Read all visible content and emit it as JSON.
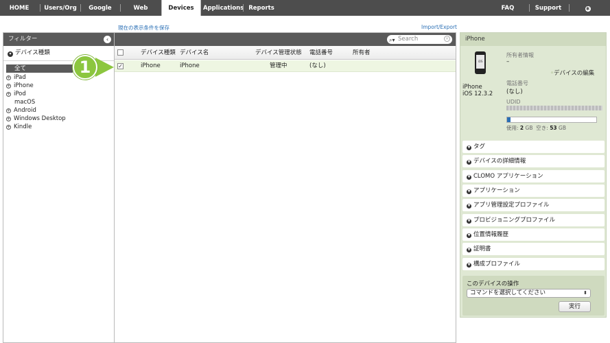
{
  "nav": {
    "home": "HOME",
    "users": "Users/Org",
    "google": "Google Apps",
    "web": "Web Access",
    "devices": "Devices",
    "applications": "Applications",
    "reports": "Reports",
    "faq": "FAQ",
    "support": "Support",
    "settings": "Settings"
  },
  "links": {
    "save_view": "現在の表示条件を保存",
    "import_export": "Import/Export"
  },
  "filter": {
    "title": "フィルター",
    "group": "デバイス種類",
    "items": [
      "全て",
      "iPad",
      "iPhone",
      "iPod",
      "macOS",
      "Android",
      "Windows Desktop",
      "Kindle"
    ]
  },
  "callout": {
    "number": "1"
  },
  "search": {
    "placeholder": "Search"
  },
  "table": {
    "headers": {
      "type": "デバイス種類",
      "name": "デバイス名",
      "status": "デバイス管理状態",
      "phone": "電話番号",
      "owner": "所有者"
    },
    "rows": [
      {
        "checked": "✓",
        "type": "iPhone",
        "name": "iPhone",
        "status": "管理中",
        "phone": "(なし)",
        "owner": ""
      }
    ]
  },
  "detail": {
    "title": "iPhone",
    "device_model": "iPhone",
    "os": "iOS 12.3.2",
    "screen_text": "iOS",
    "owner_label": "所有者情報",
    "owner_value": "–",
    "edit_link": "デバイスの編集",
    "phone_label": "電話番号",
    "phone_value": "(なし)",
    "udid_label": "UDID",
    "storage": {
      "used_label": "使用:",
      "used_value": "2",
      "used_unit": "GB",
      "free_label": "空き:",
      "free_value": "53",
      "free_unit": "GB",
      "used_fraction": 0.036
    },
    "sections": [
      "タグ",
      "デバイスの詳細情報",
      "CLOMO アプリケーション",
      "アプリケーション",
      "アプリ管理設定プロファイル",
      "プロビジョニングプロファイル",
      "位置情報履歴",
      "証明書",
      "構成プロファイル"
    ],
    "ops": {
      "title": "このデバイスの操作",
      "select_value": "コマンドを選択してください",
      "run": "実行"
    }
  },
  "colors": {
    "nav_bg": "#4d4d4d",
    "accent_green": "#8cc63f",
    "panel_green": "#dfe8d3",
    "link_blue": "#2a6fb5",
    "row_selected": "#eef6e2"
  }
}
